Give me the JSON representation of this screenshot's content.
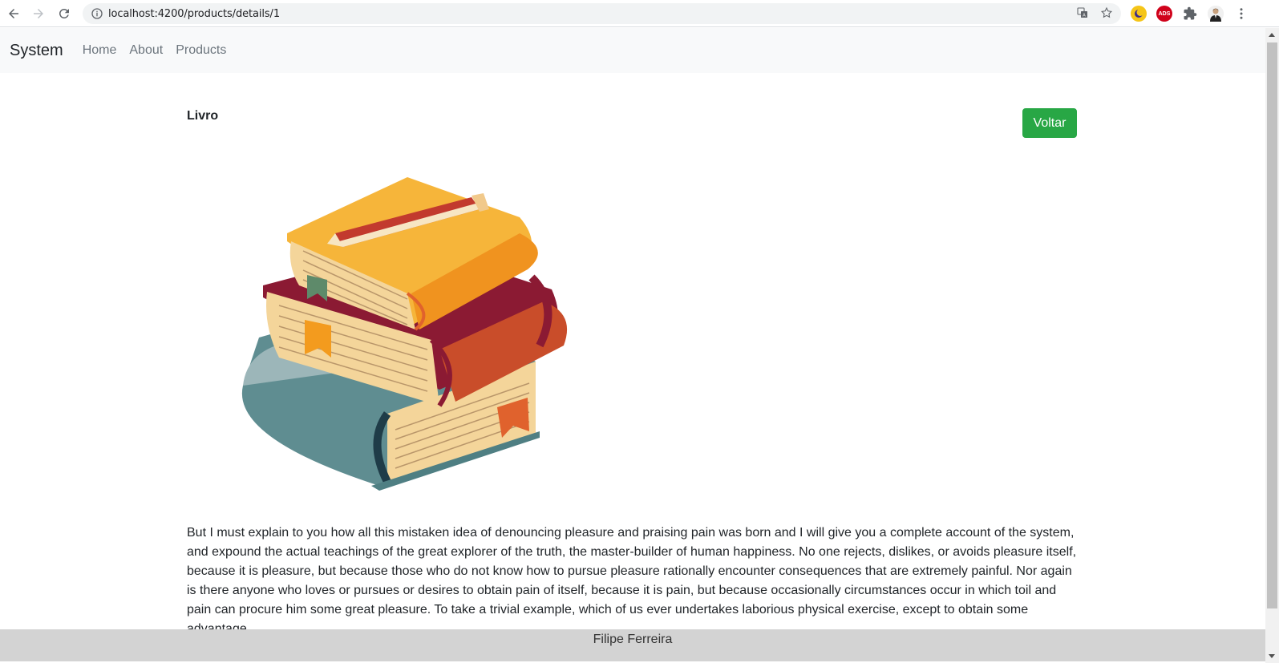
{
  "browser": {
    "url": "localhost:4200/products/details/1",
    "icons": [
      "back-icon",
      "forward-icon",
      "reload-icon",
      "info-icon",
      "translate-icon",
      "star-icon",
      "extension-moon-icon",
      "adblock-icon",
      "puzzle-icon",
      "profile-avatar",
      "menu-dots-icon"
    ],
    "adblock_label": "ADS"
  },
  "navbar": {
    "brand": "System",
    "links": [
      {
        "label": "Home"
      },
      {
        "label": "About"
      },
      {
        "label": "Products"
      }
    ]
  },
  "product": {
    "title": "Livro",
    "back_button": "Voltar",
    "image_alt": "books-illustration",
    "description": "But I must explain to you how all this mistaken idea of denouncing pleasure and praising pain was born and I will give you a complete account of the system, and expound the actual teachings of the great explorer of the truth, the master-builder of human happiness. No one rejects, dislikes, or avoids pleasure itself, because it is pleasure, but because those who do not know how to pursue pleasure rationally encounter consequences that are extremely painful. Nor again is there anyone who loves or pursues or desires to obtain pain of itself, because it is pain, but because occasionally circumstances occur in which toil and pain can procure him some great pleasure. To take a trivial example, which of us ever undertakes laborious physical exercise, except to obtain some advantage"
  },
  "footer": {
    "text": "Filipe Ferreira"
  },
  "colors": {
    "success": "#28a745",
    "navbar_bg": "#f8f9fa",
    "footer_bg": "#d3d3d3"
  }
}
